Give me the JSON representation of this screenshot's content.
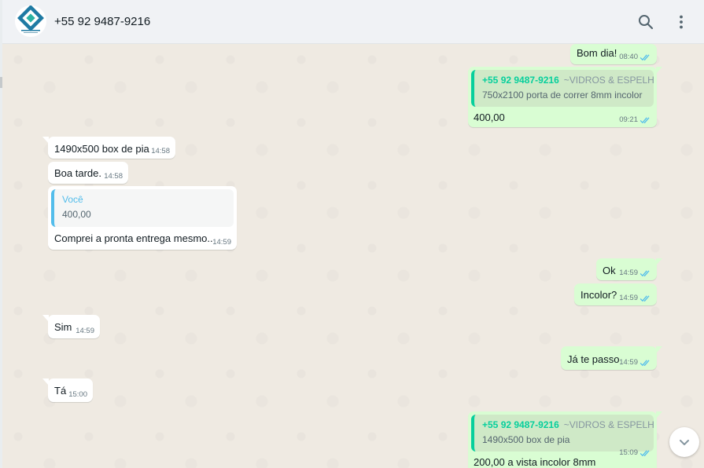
{
  "header": {
    "contact_name": "+55 92 9487-9216",
    "icons": [
      "avatar-logo",
      "search-icon",
      "menu-icon"
    ]
  },
  "colors": {
    "outgoing_bubble": "#d9fdd3",
    "incoming_bubble": "#ffffff",
    "read_ticks": "#53bdeb",
    "quote_author_out": "#06cf9c",
    "quote_author_in": "#53bdeb",
    "chat_background": "#efeae2"
  },
  "messages": [
    {
      "direction": "out",
      "text": "Bom dia!",
      "time": "08:40",
      "status": "read"
    },
    {
      "direction": "out",
      "quote": {
        "author": "+55 92 9487-9216",
        "author_sub": "~VIDROS & ESPELHOS",
        "text": "750x2100 porta de correr 8mm incolor"
      },
      "text": "400,00",
      "time": "09:21",
      "status": "read"
    },
    {
      "direction": "in",
      "text": "1490x500 box de pia",
      "time": "14:58"
    },
    {
      "direction": "in",
      "text": "Boa tarde.",
      "time": "14:58"
    },
    {
      "direction": "in",
      "quote": {
        "author": "Você",
        "text": "400,00"
      },
      "text": "Comprei a pronta entrega mesmo..",
      "time": "14:59"
    },
    {
      "direction": "out",
      "text": "Ok",
      "time": "14:59",
      "status": "read"
    },
    {
      "direction": "out",
      "text": "Incolor?",
      "time": "14:59",
      "status": "read"
    },
    {
      "direction": "in",
      "text": "Sim",
      "time": "14:59"
    },
    {
      "direction": "out",
      "text": "Já te passo",
      "time": "14:59",
      "status": "read"
    },
    {
      "direction": "in",
      "text": "Tá",
      "time": "15:00"
    },
    {
      "direction": "out",
      "quote": {
        "author": "+55 92 9487-9216",
        "author_sub": "~VIDROS & ESPELHOS",
        "text": "1490x500 box de pia"
      },
      "text": "200,00 a vista incolor 8mm",
      "time": "15:09",
      "status": "read"
    }
  ]
}
